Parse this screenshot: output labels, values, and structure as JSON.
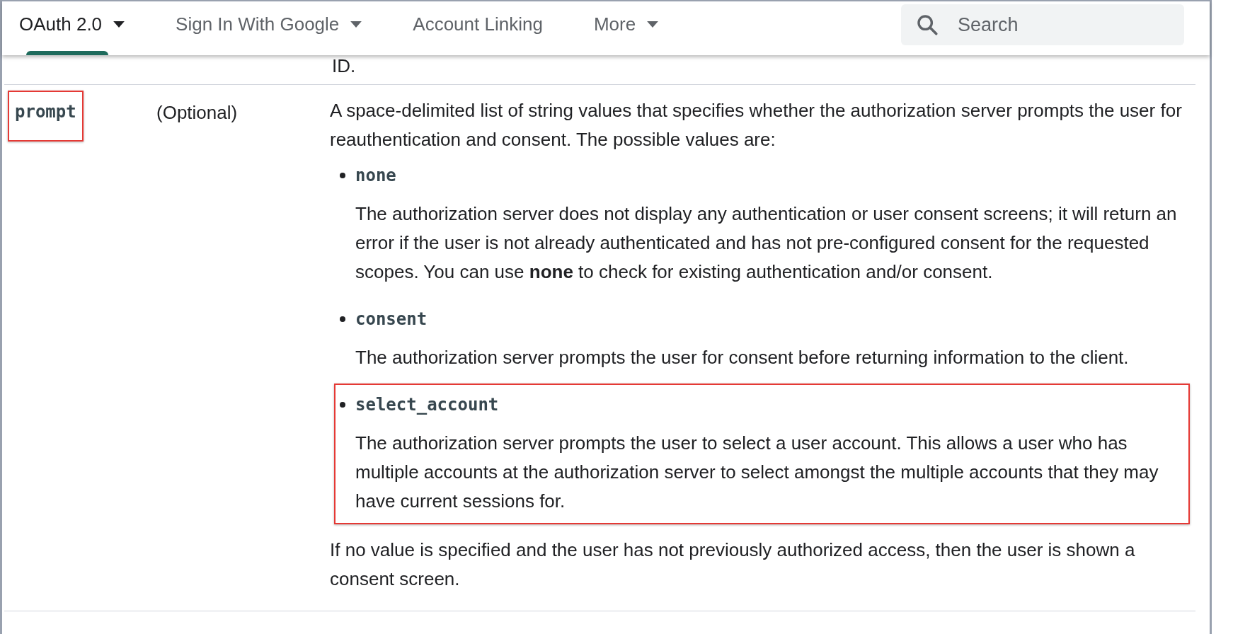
{
  "nav": {
    "tabs": [
      {
        "label": "OAuth 2.0",
        "selected": true,
        "dropdown": true
      },
      {
        "label": "Sign In With Google",
        "selected": false,
        "dropdown": true
      },
      {
        "label": "Account Linking",
        "selected": false,
        "dropdown": false
      },
      {
        "label": "More",
        "selected": false,
        "dropdown": true
      }
    ],
    "search": {
      "placeholder": "Search"
    }
  },
  "previous_row_tail": "ID.",
  "parameter": {
    "name": "prompt",
    "highlighted": true,
    "requirement": "(Optional)",
    "intro": "A space-delimited list of string values that specifies whether the authorization server prompts the user for reauthentication and consent. The possible values are:",
    "values": [
      {
        "name": "none",
        "highlighted": false,
        "description": "The authorization server does not display any authentication or user consent screens; it will return an error if the user is not already authenticated and has not pre-configured consent for the requested scopes. You can use **none** to check for existing authentication and/or consent."
      },
      {
        "name": "consent",
        "highlighted": false,
        "description": "The authorization server prompts the user for consent before returning information to the client."
      },
      {
        "name": "select_account",
        "highlighted": true,
        "description": "The authorization server prompts the user to select a user account. This allows a user who has multiple accounts at the authorization server to select amongst the multiple accounts that they may have current sessions for."
      }
    ],
    "note": "If no value is specified and the user has not previously authorized access, then the user is shown a consent screen."
  }
}
